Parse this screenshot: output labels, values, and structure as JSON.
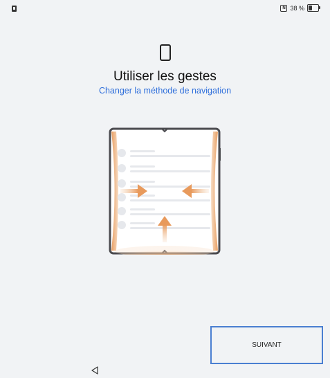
{
  "status_bar": {
    "battery_text": "38 %",
    "battery_level": 0.38,
    "nfc_label": "N"
  },
  "header": {
    "title": "Utiliser les gestes",
    "link_label": "Changer la méthode de navigation"
  },
  "illustration": {
    "frame_color": "#4a4a4e",
    "accent_color": "#e8a065",
    "list_rows": 6
  },
  "footer": {
    "next_label": "SUIVANT"
  },
  "colors": {
    "link": "#2f6fdb",
    "button_border": "#4a7fd1",
    "background": "#f1f3f5"
  }
}
